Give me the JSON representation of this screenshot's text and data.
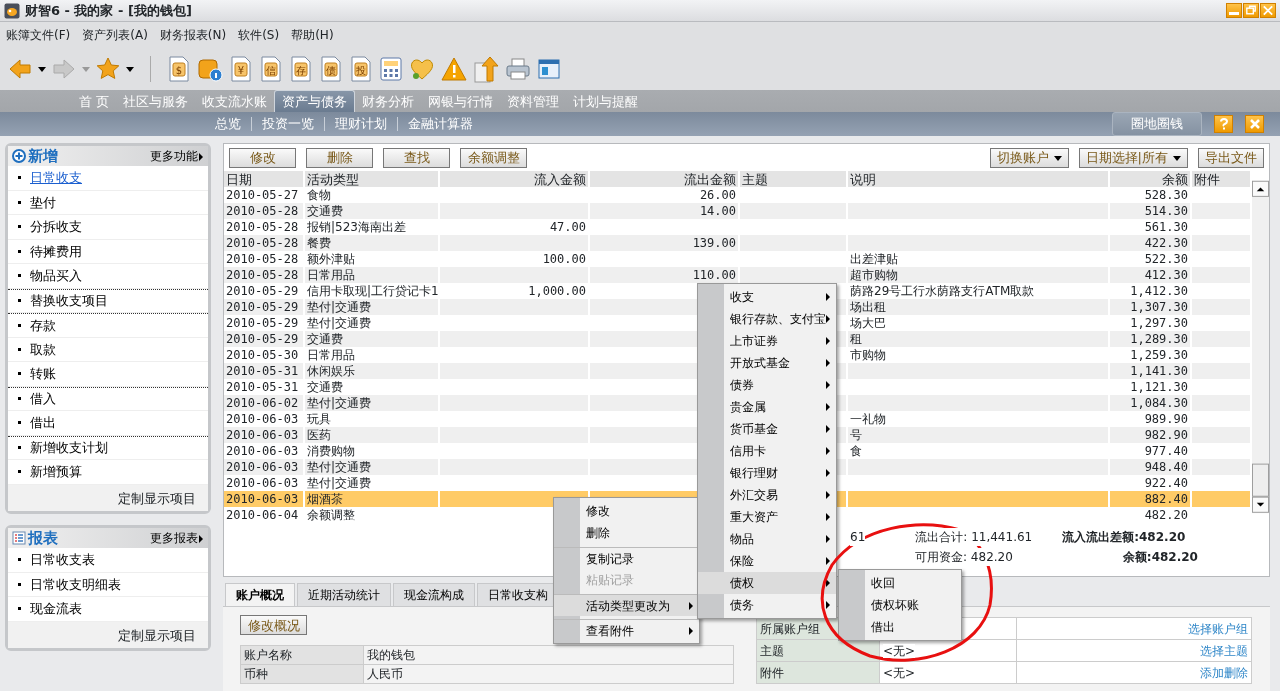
{
  "window": {
    "title": "财智6 - 我的家 - [我的钱包]"
  },
  "menu_bar": [
    "账簿文件(F)",
    "资产列表(A)",
    "财务报表(N)",
    "软件(S)",
    "帮助(H)"
  ],
  "toolbar": {
    "nav": [
      {
        "kind": "back",
        "disabled": false
      },
      {
        "kind": "forward",
        "disabled": true
      },
      {
        "kind": "star",
        "disabled": false
      }
    ],
    "icons": [
      {
        "kind": "doc",
        "glyph": "$"
      },
      {
        "kind": "badge"
      },
      {
        "kind": "doc",
        "glyph": "¥"
      },
      {
        "kind": "doc",
        "glyph": "信"
      },
      {
        "kind": "doc",
        "glyph": "存"
      },
      {
        "kind": "doc",
        "glyph": "债"
      },
      {
        "kind": "doc",
        "glyph": "投"
      },
      {
        "kind": "calculator"
      },
      {
        "kind": "heart"
      },
      {
        "kind": "warning"
      },
      {
        "kind": "upload"
      },
      {
        "kind": "printer"
      },
      {
        "kind": "window"
      }
    ]
  },
  "main_tabs": [
    {
      "label": "首 页",
      "selected": false
    },
    {
      "label": "社区与服务",
      "selected": false
    },
    {
      "label": "收支流水账",
      "selected": false
    },
    {
      "label": "资产与债务",
      "selected": true
    },
    {
      "label": "财务分析",
      "selected": false
    },
    {
      "label": "网银与行情",
      "selected": false
    },
    {
      "label": "资料管理",
      "selected": false
    },
    {
      "label": "计划与提醒",
      "selected": false
    }
  ],
  "sub_tabs": [
    "总览",
    "投资一览",
    "理财计划",
    "金融计算器"
  ],
  "sub_bar_button": "圈地圈钱",
  "sidebar": {
    "new_panel": {
      "title": "新增",
      "more": "更多功能",
      "groups": [
        [
          {
            "label": "日常收支",
            "selected": true
          },
          {
            "label": "垫付",
            "selected": false
          },
          {
            "label": "分拆收支",
            "selected": false
          },
          {
            "label": "待摊费用",
            "selected": false
          },
          {
            "label": "物品买入",
            "selected": false
          }
        ],
        [
          {
            "label": "替换收支项目",
            "selected": false
          }
        ],
        [
          {
            "label": "存款",
            "selected": false
          },
          {
            "label": "取款",
            "selected": false
          },
          {
            "label": "转账",
            "selected": false
          }
        ],
        [
          {
            "label": "借入",
            "selected": false
          },
          {
            "label": "借出",
            "selected": false
          }
        ],
        [
          {
            "label": "新增收支计划",
            "selected": false
          },
          {
            "label": "新增预算",
            "selected": false
          }
        ]
      ],
      "footer": "定制显示项目"
    },
    "report_panel": {
      "title": "报表",
      "more": "更多报表",
      "items": [
        "日常收支表",
        "日常收支明细表",
        "现金流表"
      ],
      "footer": "定制显示项目"
    }
  },
  "ledger_toolbar": {
    "left": [
      "修改",
      "删除",
      "查找",
      "余额调整"
    ],
    "right": [
      {
        "label": "切换账户",
        "dropdown": true
      },
      {
        "label": "日期选择|所有",
        "dropdown": true
      },
      {
        "label": "导出文件",
        "dropdown": false
      }
    ]
  },
  "table": {
    "columns": [
      "日期",
      "活动类型",
      "流入金额",
      "流出金额",
      "主题",
      "说明",
      "余额",
      "附件"
    ],
    "rows": [
      {
        "date": "2010-05-27",
        "type": "食物",
        "inflow": "",
        "outflow": "26.00",
        "description": "",
        "balance": "528.30",
        "selected": false
      },
      {
        "date": "2010-05-28",
        "type": "交通费",
        "inflow": "",
        "outflow": "14.00",
        "description": "",
        "balance": "514.30",
        "selected": false
      },
      {
        "date": "2010-05-28",
        "type": "报销|523海南出差",
        "inflow": "47.00",
        "outflow": "",
        "description": "",
        "balance": "561.30",
        "selected": false
      },
      {
        "date": "2010-05-28",
        "type": "餐费",
        "inflow": "",
        "outflow": "139.00",
        "description": "",
        "balance": "422.30",
        "selected": false
      },
      {
        "date": "2010-05-28",
        "type": "额外津贴",
        "inflow": "100.00",
        "outflow": "",
        "description": "出差津贴",
        "balance": "522.30",
        "selected": false
      },
      {
        "date": "2010-05-28",
        "type": "日常用品",
        "inflow": "",
        "outflow": "110.00",
        "description": "超市购物",
        "balance": "412.30",
        "selected": false
      },
      {
        "date": "2010-05-29",
        "type": "信用卡取现|工行贷记卡1",
        "inflow": "1,000.00",
        "outflow": "",
        "description": "荫路29号工行水荫路支行ATM取款",
        "balance": "1,412.30",
        "selected": false
      },
      {
        "date": "2010-05-29",
        "type": "垫付|交通费",
        "inflow": "",
        "outflow": "",
        "description": "场出租",
        "balance": "1,307.30",
        "selected": false
      },
      {
        "date": "2010-05-29",
        "type": "垫付|交通费",
        "inflow": "",
        "outflow": "",
        "description": "场大巴",
        "balance": "1,297.30",
        "selected": false
      },
      {
        "date": "2010-05-29",
        "type": "交通费",
        "inflow": "",
        "outflow": "",
        "description": "租",
        "balance": "1,289.30",
        "selected": false
      },
      {
        "date": "2010-05-30",
        "type": "日常用品",
        "inflow": "",
        "outflow": "",
        "description": "市购物",
        "balance": "1,259.30",
        "selected": false
      },
      {
        "date": "2010-05-31",
        "type": "休闲娱乐",
        "inflow": "",
        "outflow": "",
        "description": "",
        "balance": "1,141.30",
        "selected": false
      },
      {
        "date": "2010-05-31",
        "type": "交通费",
        "inflow": "",
        "outflow": "",
        "description": "",
        "balance": "1,121.30",
        "selected": false
      },
      {
        "date": "2010-06-02",
        "type": "垫付|交通费",
        "inflow": "",
        "outflow": "",
        "description": "",
        "balance": "1,084.30",
        "selected": false
      },
      {
        "date": "2010-06-03",
        "type": "玩具",
        "inflow": "",
        "outflow": "",
        "description": "一礼物",
        "balance": "989.90",
        "selected": false
      },
      {
        "date": "2010-06-03",
        "type": "医药",
        "inflow": "",
        "outflow": "",
        "description": "号",
        "balance": "982.90",
        "selected": false
      },
      {
        "date": "2010-06-03",
        "type": "消费购物",
        "inflow": "",
        "outflow": "",
        "description": "食",
        "balance": "977.40",
        "selected": false
      },
      {
        "date": "2010-06-03",
        "type": "垫付|交通费",
        "inflow": "",
        "outflow": "",
        "description": "",
        "balance": "948.40",
        "selected": false
      },
      {
        "date": "2010-06-03",
        "type": "垫付|交通费",
        "inflow": "",
        "outflow": "",
        "description": "",
        "balance": "922.40",
        "selected": false
      },
      {
        "date": "2010-06-03",
        "type": "烟酒茶",
        "inflow": "",
        "outflow": "",
        "description": "",
        "balance": "882.40",
        "selected": true
      },
      {
        "date": "2010-06-04",
        "type": "余额调整",
        "inflow": "",
        "outflow": "",
        "description": "",
        "balance": "482.20",
        "selected": false
      }
    ]
  },
  "summary": {
    "inflow_total_tail": "61",
    "outflow_total": "流出合计: 11,441.61",
    "difference": "流入流出差额:482.20",
    "available": "可用资金: 482.20",
    "balance": "余额:482.20"
  },
  "detail_tabs": [
    {
      "label": "账户概况",
      "selected": true
    },
    {
      "label": "近期活动统计",
      "selected": false
    },
    {
      "label": "现金流构成",
      "selected": false
    },
    {
      "label": "日常收支构",
      "selected": false
    }
  ],
  "detail": {
    "edit_button": "修改概况",
    "info_rows": [
      {
        "label": "账户名称",
        "value": "我的钱包"
      },
      {
        "label": "币种",
        "value": "人民币"
      }
    ],
    "link_rows": [
      {
        "label": "所属账户组",
        "value": "",
        "link": "选择账户组"
      },
      {
        "label": "主题",
        "value": "<无>",
        "link": "选择主题"
      },
      {
        "label": "附件",
        "value": "<无>",
        "link": "添加删除"
      }
    ]
  },
  "context_menu": [
    {
      "label": "修改",
      "disabled": false,
      "submenu": false,
      "highlighted": false,
      "separator_before": false
    },
    {
      "label": "删除",
      "disabled": false,
      "submenu": false,
      "highlighted": false,
      "separator_before": false
    },
    {
      "label": "复制记录",
      "disabled": false,
      "submenu": false,
      "highlighted": false,
      "separator_before": true
    },
    {
      "label": "粘贴记录",
      "disabled": true,
      "submenu": false,
      "highlighted": false,
      "separator_before": false
    },
    {
      "label": "活动类型更改为",
      "disabled": false,
      "submenu": true,
      "highlighted": true,
      "separator_before": true
    },
    {
      "label": "查看附件",
      "disabled": false,
      "submenu": true,
      "highlighted": false,
      "separator_before": true
    }
  ],
  "type_submenu": [
    {
      "label": "收支",
      "highlighted": false
    },
    {
      "label": "银行存款、支付宝",
      "highlighted": false
    },
    {
      "label": "上市证券",
      "highlighted": false
    },
    {
      "label": "开放式基金",
      "highlighted": false
    },
    {
      "label": "债券",
      "highlighted": false
    },
    {
      "label": "贵金属",
      "highlighted": false
    },
    {
      "label": "货币基金",
      "highlighted": false
    },
    {
      "label": "信用卡",
      "highlighted": false
    },
    {
      "label": "银行理财",
      "highlighted": false
    },
    {
      "label": "外汇交易",
      "highlighted": false
    },
    {
      "label": "重大资产",
      "highlighted": false
    },
    {
      "label": "物品",
      "highlighted": false
    },
    {
      "label": "保险",
      "highlighted": false
    },
    {
      "label": "债权",
      "highlighted": true
    },
    {
      "label": "债务",
      "highlighted": false
    }
  ],
  "claim_submenu": [
    "收回",
    "债权坏账",
    "借出"
  ],
  "annotation": {
    "kind": "circle"
  }
}
